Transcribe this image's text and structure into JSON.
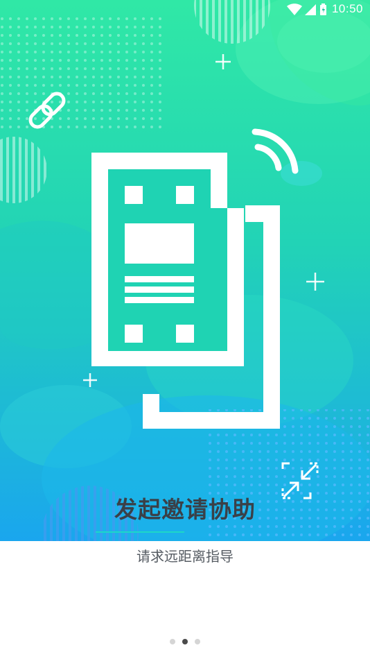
{
  "status_bar": {
    "time": "10:50",
    "icons": [
      "wifi-icon",
      "cellular-signal-icon",
      "battery-icon"
    ]
  },
  "onboarding": {
    "title": "发起邀请协助",
    "subtitle": "请求远距离指导",
    "page_indicator": {
      "total": 3,
      "active_index": 1
    }
  },
  "colors": {
    "gradient_top": "#2ee6a8",
    "gradient_bottom": "#1aa9f0",
    "title_text": "#3a4048",
    "subtitle_text": "#555b62",
    "underline": "#1ed7c8"
  }
}
